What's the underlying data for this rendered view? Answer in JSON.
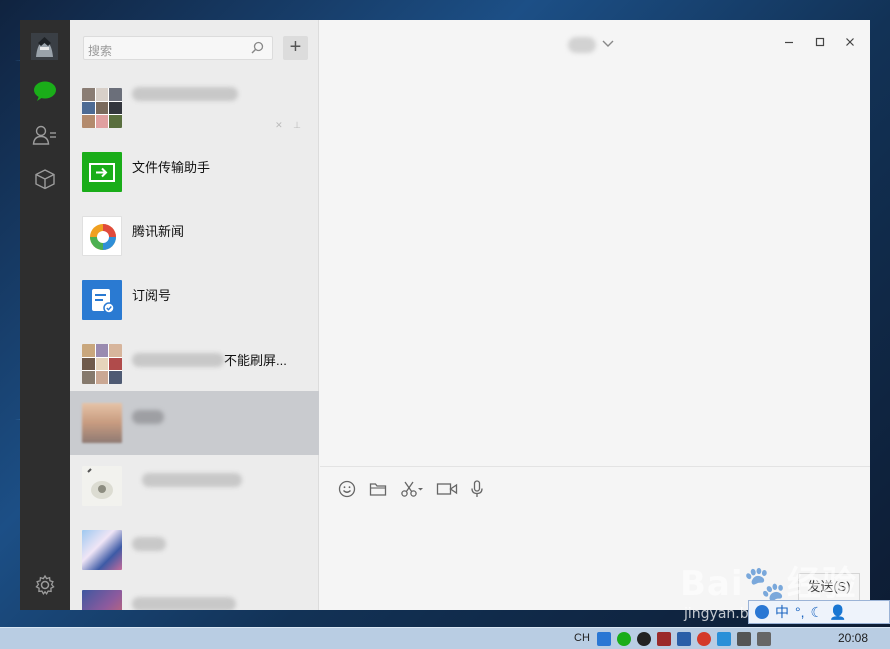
{
  "search": {
    "placeholder": "搜索"
  },
  "conversations": [
    {
      "title": "",
      "muted": true,
      "pinned": true
    },
    {
      "title": "文件传输助手"
    },
    {
      "title": "腾讯新闻"
    },
    {
      "title": "订阅号"
    },
    {
      "title_suffix": "不能刷屏..."
    },
    {
      "title": "",
      "selected": true
    },
    {
      "title_suffix": ""
    },
    {
      "title": ""
    },
    {
      "title": ""
    }
  ],
  "chat": {
    "send_label": "发送(S)"
  },
  "taskbar": {
    "lang": "CH",
    "clock": "20:08"
  },
  "ime": {
    "mode": "中"
  },
  "colors": {
    "rail": "#2e2e2e",
    "accent_green": "#1aad19",
    "selected_row": "#c9cbcf",
    "chat_bg": "#f5f5f5"
  },
  "icons": {
    "rail": [
      "user-avatar",
      "chat-icon",
      "contacts-icon",
      "favorites-icon",
      "settings-icon"
    ],
    "toolbar": [
      "emoji-icon",
      "folder-icon",
      "scissors-icon",
      "video-call-icon",
      "microphone-icon"
    ]
  }
}
